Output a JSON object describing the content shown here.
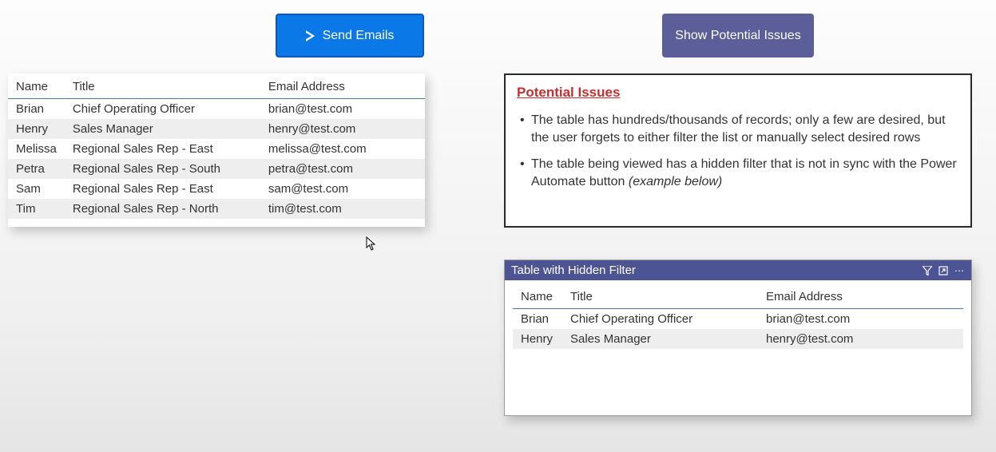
{
  "buttons": {
    "send": "Send Emails",
    "show": "Show Potential Issues"
  },
  "mainTable": {
    "headers": {
      "name": "Name",
      "title": "Title",
      "email": "Email Address"
    },
    "rows": [
      {
        "name": "Brian",
        "title": "Chief Operating Officer",
        "email": "brian@test.com"
      },
      {
        "name": "Henry",
        "title": "Sales Manager",
        "email": "henry@test.com"
      },
      {
        "name": "Melissa",
        "title": "Regional Sales Rep - East",
        "email": "melissa@test.com"
      },
      {
        "name": "Petra",
        "title": "Regional Sales Rep - South",
        "email": "petra@test.com"
      },
      {
        "name": "Sam",
        "title": "Regional Sales Rep - East",
        "email": "sam@test.com"
      },
      {
        "name": "Tim",
        "title": "Regional Sales Rep - North",
        "email": "tim@test.com"
      }
    ]
  },
  "issues": {
    "title": "Potential Issues",
    "items": [
      "The table has hundreds/thousands of records; only a few are desired, but the user forgets to either filter the list or manually select desired rows",
      "The table being viewed has a hidden filter that is not in sync with the Power Automate button (example below)"
    ]
  },
  "filteredTable": {
    "title": "Table with Hidden Filter",
    "headers": {
      "name": "Name",
      "title": "Title",
      "email": "Email Address"
    },
    "rows": [
      {
        "name": "Brian",
        "title": "Chief Operating Officer",
        "email": "brian@test.com"
      },
      {
        "name": "Henry",
        "title": "Sales Manager",
        "email": "henry@test.com"
      }
    ]
  }
}
